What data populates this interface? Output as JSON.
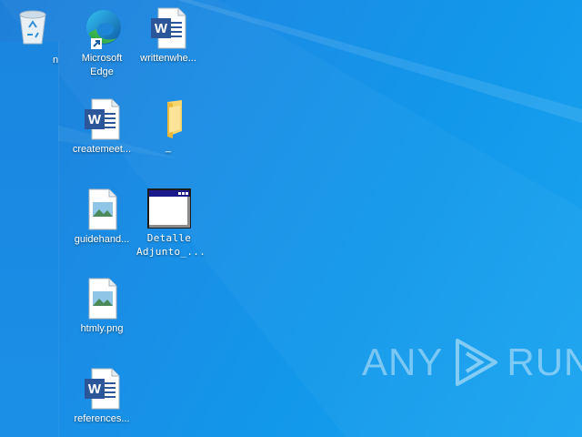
{
  "desktop": {
    "recycle_bin": {
      "label_fragment": "n",
      "icon": "recycle-bin-icon"
    },
    "icons": [
      {
        "label": "Microsoft\nEdge",
        "icon": "edge-icon"
      },
      {
        "label": "writtenwhe...",
        "icon": "word-document-icon"
      },
      {
        "label": "createmeet...",
        "icon": "word-document-icon"
      },
      {
        "label": "_",
        "icon": "folder-icon"
      },
      {
        "label": "guidehand...",
        "icon": "image-file-icon"
      },
      {
        "label": "Detalle\nAdjunto_...",
        "icon": "application-window-icon"
      },
      {
        "label": "htmly.png",
        "icon": "image-file-icon"
      },
      {
        "label": "references...",
        "icon": "word-document-icon"
      }
    ]
  },
  "watermark": {
    "left_text": "ANY",
    "right_text": "RUN",
    "icon": "anyrun-play-logo-icon"
  },
  "colors": {
    "desktop_blue": "#1a8ee6",
    "word_blue": "#2b579a",
    "folder_yellow": "#f3c84a"
  }
}
